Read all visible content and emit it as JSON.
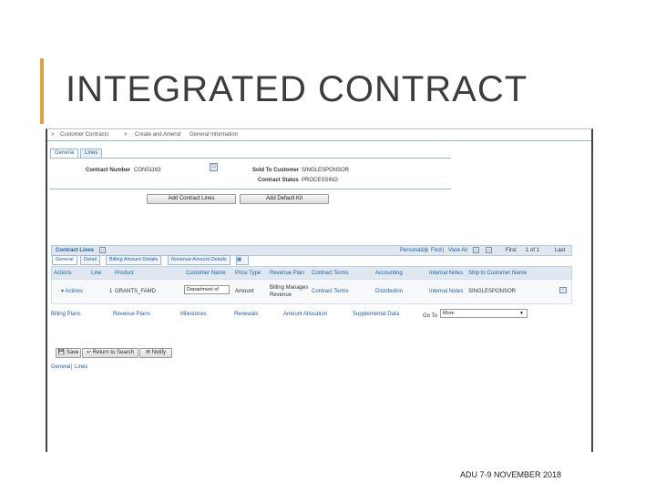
{
  "slide": {
    "title": "INTEGRATED CONTRACT",
    "footer": "ADU 7-9 NOVEMBER 2018",
    "accent_color": "#e2a23a"
  },
  "nav": {
    "items": [
      "Customer Contracts",
      "Create and Amend",
      "General Information"
    ],
    "separator": ">"
  },
  "tabs": [
    "General",
    "Lines"
  ],
  "header": {
    "contract_number_label": "Contract Number",
    "contract_number_value": "CON51163",
    "sold_to_label": "Sold To Customer",
    "sold_to_value": "SINGLESPONSOR",
    "status_label": "Contract Status",
    "status_value": "PROCESSING",
    "add_lines_button": "Add Contract Lines",
    "add_kit_button": "Add Default Kit"
  },
  "grid": {
    "title": "Contract Lines",
    "toolbar": {
      "personalize": "Personalize",
      "find": "Find",
      "view_all": "View All",
      "first": "First",
      "pagination": "1 of 1",
      "last": "Last"
    },
    "subtabs": [
      "General",
      "Detail",
      "Billing Amount Details",
      "Revenue Amount Details"
    ],
    "columns": [
      "Actions",
      "Line",
      "Product",
      "Customer Name",
      "Price Type",
      "Revenue Plan",
      "Contract Terms",
      "Accounting",
      "Internal Notes",
      "Ship to Customer Name"
    ],
    "row": {
      "actions": "Actions",
      "line": "1",
      "product": "GRANTS_FAMD",
      "customer_name": "Department of",
      "price_type": "Amount",
      "revenue_plan": "Billing Manages Revenue",
      "contract_terms": "Contract Terms",
      "accounting": "Distribution",
      "internal_notes": "Internal Notes",
      "ship_to": "SINGLESPONSOR"
    }
  },
  "links": [
    "Billing Plans",
    "Revenue Plans",
    "Milestones",
    "Renewals",
    "Amount Allocation",
    "Supplemental Data"
  ],
  "goto": {
    "label": "Go To",
    "value": "More"
  },
  "actions": {
    "save": "Save",
    "return": "Return to Search",
    "notify": "Notify"
  },
  "bottom_links": {
    "general": "General",
    "separator": "|",
    "lines": "Lines"
  }
}
